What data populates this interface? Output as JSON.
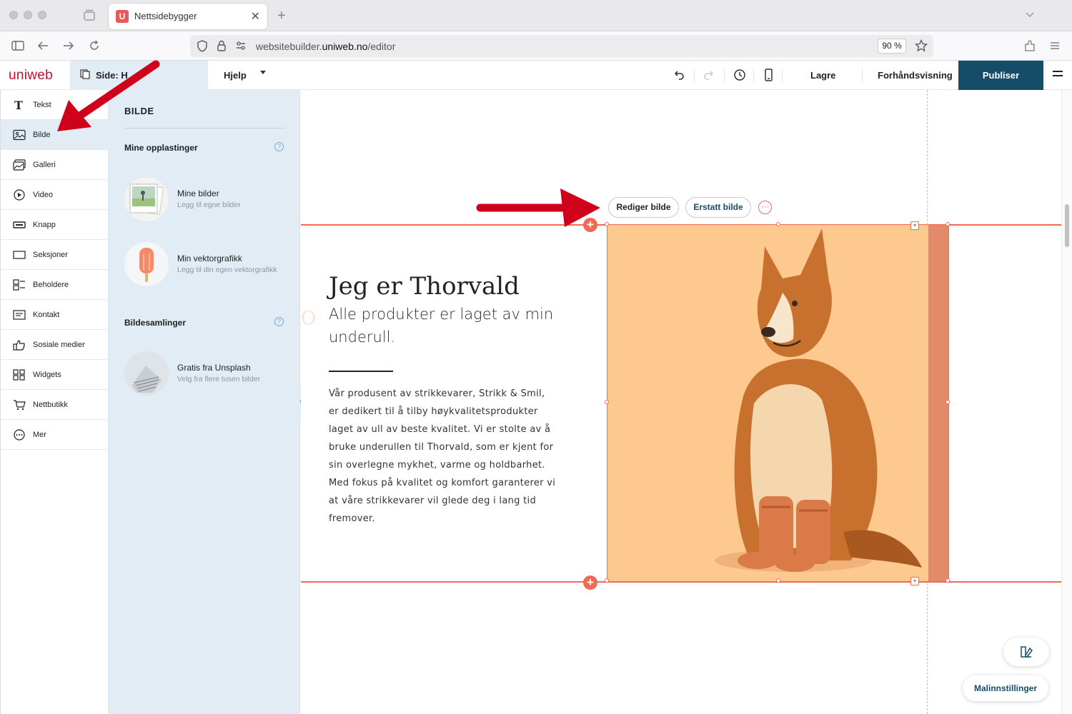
{
  "browser": {
    "tab_title": "Nettsidebygger",
    "tab_favicon": "U",
    "url_host_prefix": "websitebuilder.",
    "url_host_main": "uniweb.no",
    "url_path": "/editor",
    "zoom": "90 %"
  },
  "toolbar": {
    "logo": "uniweb",
    "page_label": "Side: H",
    "help": "Hjelp",
    "save": "Lagre",
    "preview": "Forhåndsvisning",
    "publish": "Publiser"
  },
  "elements": [
    {
      "label": "Tekst",
      "icon": "text-icon"
    },
    {
      "label": "Bilde",
      "icon": "image-icon"
    },
    {
      "label": "Galleri",
      "icon": "gallery-icon"
    },
    {
      "label": "Video",
      "icon": "video-icon"
    },
    {
      "label": "Knapp",
      "icon": "button-icon"
    },
    {
      "label": "Seksjoner",
      "icon": "section-icon"
    },
    {
      "label": "Beholdere",
      "icon": "container-icon"
    },
    {
      "label": "Kontakt",
      "icon": "contact-icon"
    },
    {
      "label": "Sosiale medier",
      "icon": "thumbs-up-icon"
    },
    {
      "label": "Widgets",
      "icon": "widgets-icon"
    },
    {
      "label": "Nettbutikk",
      "icon": "cart-icon"
    },
    {
      "label": "Mer",
      "icon": "more-icon"
    }
  ],
  "panel": {
    "title": "BILDE",
    "uploads_title": "Mine opplastinger",
    "help_glyph": "?",
    "my_images_title": "Mine bilder",
    "my_images_sub": "Legg til egne bilder",
    "vector_title": "Min vektorgrafikk",
    "vector_sub": "Legg til din egen vektorgrafikk",
    "collections_title": "Bildesamlinger",
    "unsplash_title": "Gratis fra Unsplash",
    "unsplash_sub": "Velg fra flere tusen bilder"
  },
  "canvas": {
    "edit_image": "Rediger bilde",
    "replace_image": "Erstatt bilde",
    "more_glyph": "···",
    "heading": "Jeg er Thorvald",
    "subheading": "Alle produkter er laget av min underull.",
    "body": "Vår produsent av strikkevarer, Strikk & Smil, er dedikert til å tilby høykvalitetsprodukter laget av ull av beste kvalitet. Vi er stolte av å bruke underullen til Thorvald, som er kjent for sin overlegne mykhet, varme og holdbarhet. Med fokus på kvalitet og komfort garanterer vi at våre strikkevarer vil glede deg i lang tid fremover.",
    "template_settings": "Malinnstillinger"
  },
  "colors": {
    "accent": "#f06b55",
    "publish_bg": "#154d69",
    "panel_bg": "#e2ecf5",
    "image_bg": "#fdc98f",
    "annotation_arrow": "#d0021b"
  }
}
